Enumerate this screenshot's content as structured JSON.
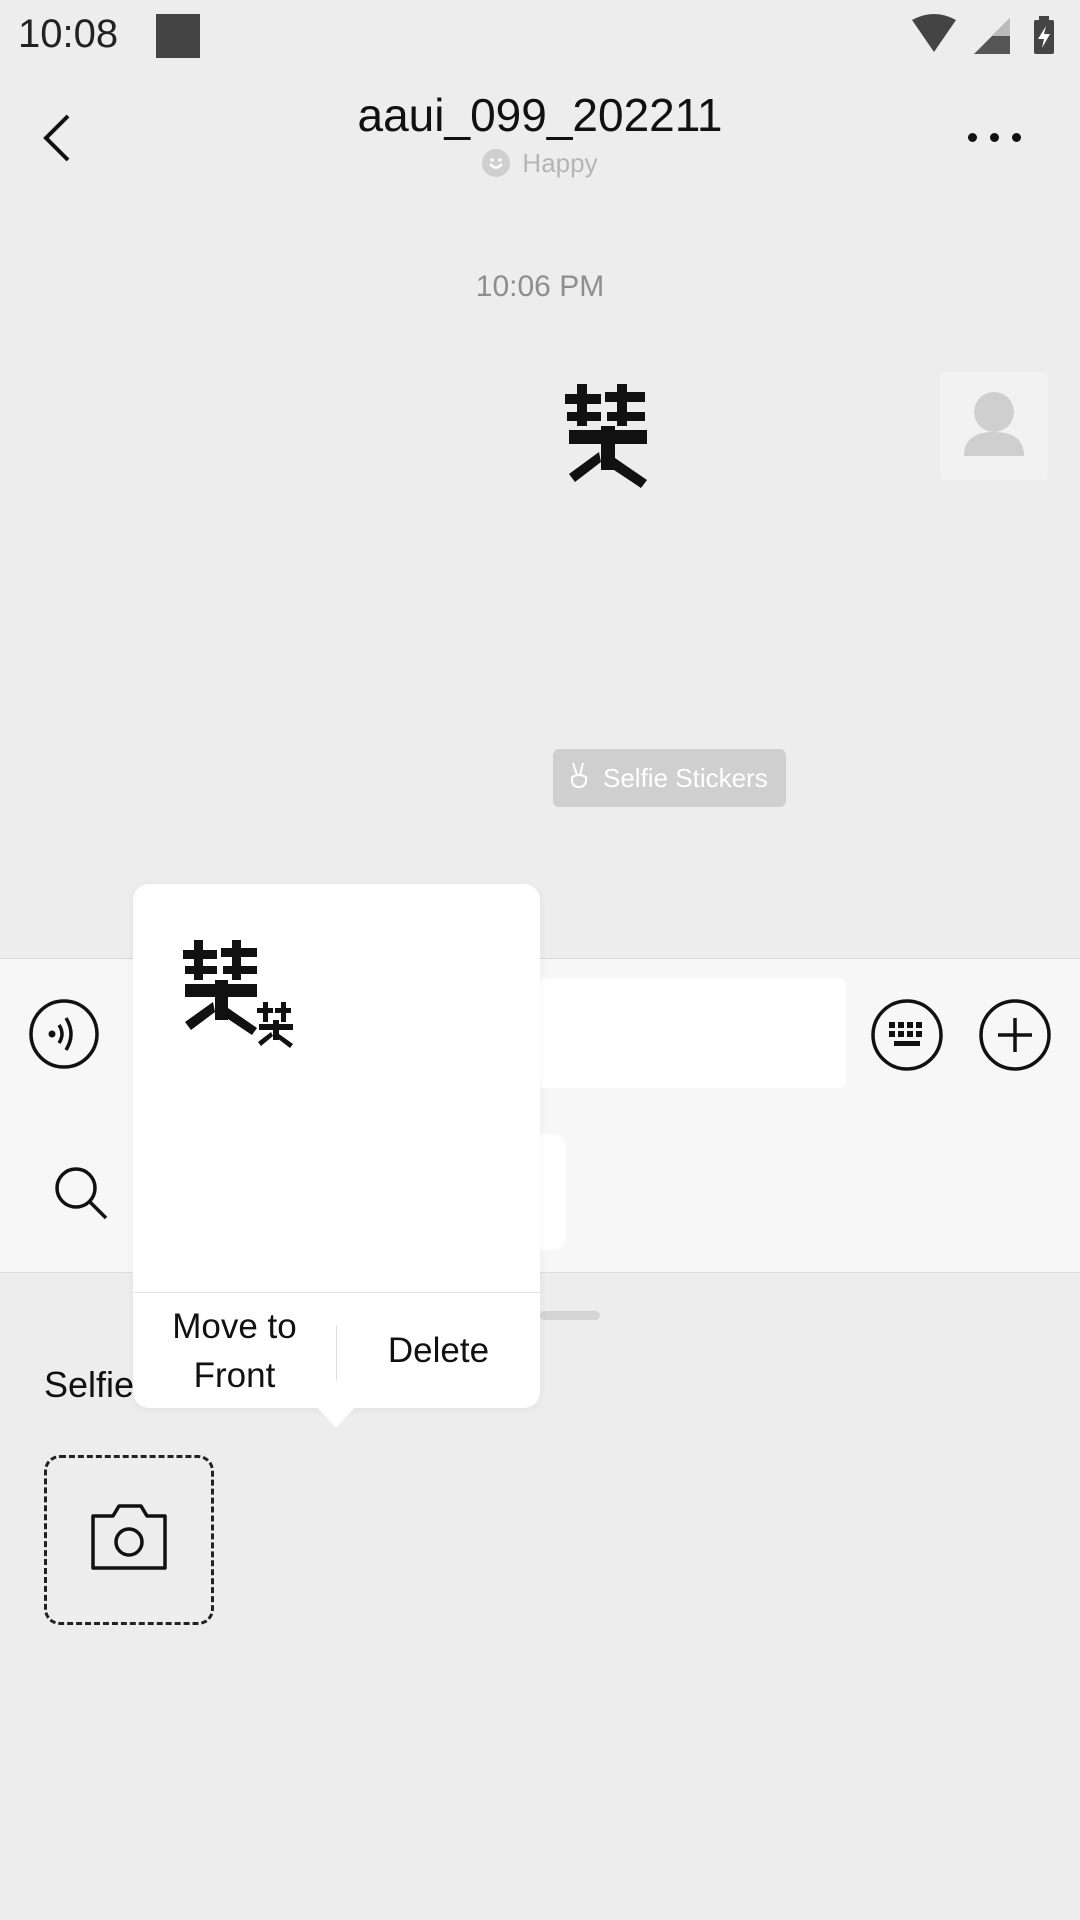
{
  "status_bar": {
    "time": "10:08"
  },
  "header": {
    "title": "aaui_099_202211",
    "status": "Happy"
  },
  "chat": {
    "timestamp": "10:06 PM",
    "selfie_stickers_label": "Selfie Stickers"
  },
  "sticker_panel": {
    "section_label": "Selfie"
  },
  "popup": {
    "move_to_front_label": "Move to\nFront",
    "delete_label": "Delete"
  },
  "icons": {
    "back": "back-arrow-icon",
    "more": "more-dots-icon",
    "voice": "voice-icon",
    "keyboard": "keyboard-icon",
    "plus": "plus-icon",
    "search": "search-icon",
    "camera": "camera-icon"
  },
  "colors": {
    "background": "#ededed",
    "panel": "#f7f7f7",
    "chip": "#cfcfcf"
  }
}
